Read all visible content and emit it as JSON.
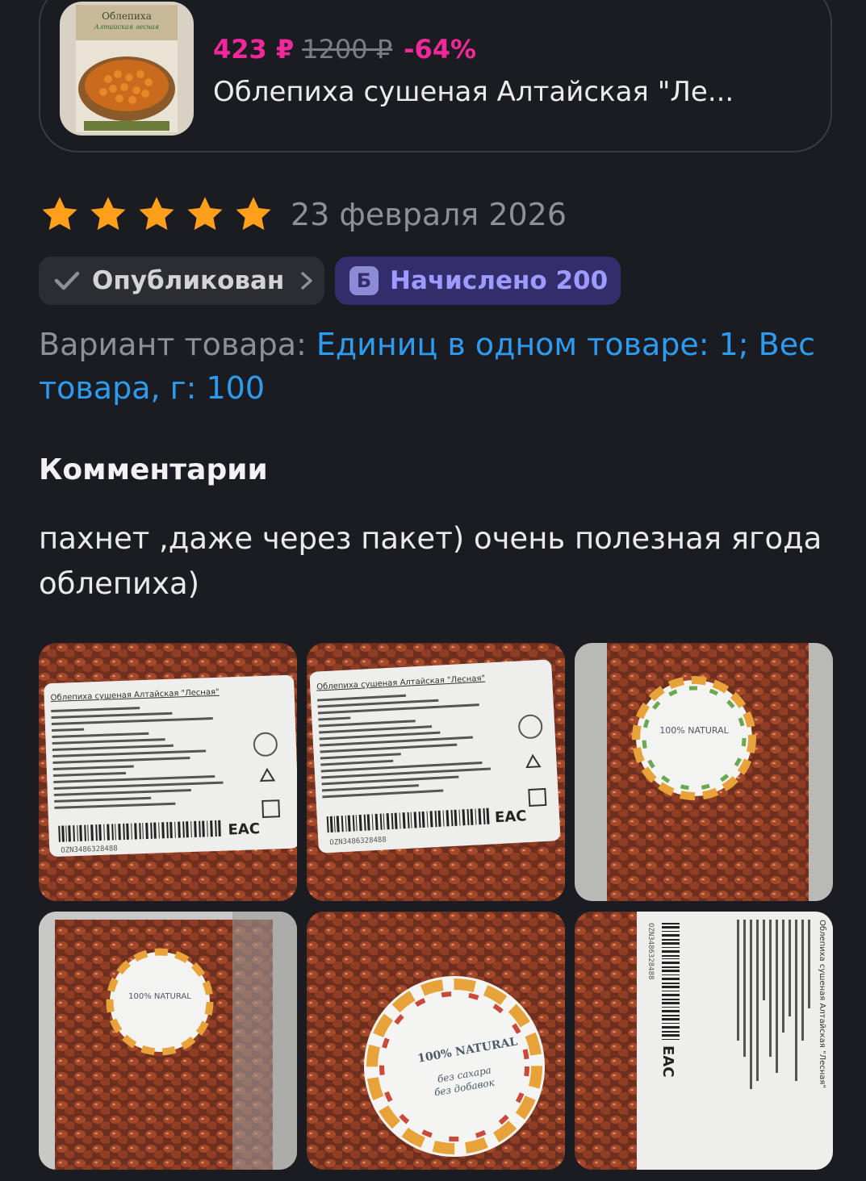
{
  "product": {
    "price": "423 ₽",
    "old_price": "1200 ₽",
    "discount": "-64%",
    "name": "Облепиха сушеная Алтайская \"Ле...",
    "thumb_title": "Облепиха",
    "thumb_subtitle": "Алтайская лесная"
  },
  "review": {
    "rating": 5,
    "date": "23 февраля 2026",
    "status_label": "Опубликован",
    "bonus_icon": "Б",
    "bonus_label": "Начислено 200",
    "variant_label": "Вариант товара: ",
    "variant_value": "Единиц в одном товаре: 1; Вес товара, г: 100",
    "comments_title": "Комментарии",
    "comment": "пахнет ,даже через пакет) очень полезная ягода облепиха)"
  },
  "photos": [
    {
      "label_title": "Облепиха сушеная Алтайская \"Лесная\"",
      "code": "OZN3486328488"
    },
    {
      "label_title": "Облепиха сушеная Алтайская \"Лесная\"",
      "code": "OZN3486328488"
    },
    {
      "sticker_text": "100% NATURAL"
    },
    {
      "sticker_text": "100% NATURAL"
    },
    {
      "sticker_text": "100% NATURAL",
      "sticker_sub1": "без сахара",
      "sticker_sub2": "без добавок"
    },
    {
      "label_title": "Облепиха сушеная Алтайская \"Лесная\"",
      "code": "OZN3486328488"
    }
  ],
  "colors": {
    "background": "#1b1c21",
    "price": "#f0289a",
    "link": "#2c9cf0",
    "star": "#ff9f1a",
    "bonus_chip": "#332d6b"
  }
}
